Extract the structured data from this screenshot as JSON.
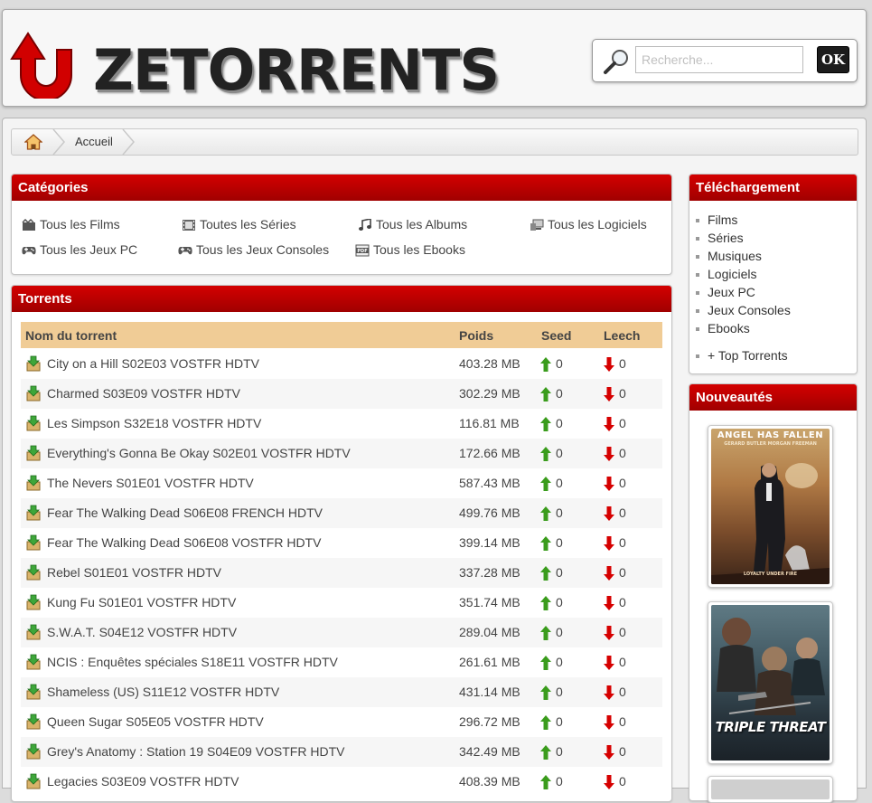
{
  "header": {
    "logo_text": "ZETORRENTS",
    "search_placeholder": "Recherche...",
    "ok_label": "OK"
  },
  "breadcrumb": {
    "home_icon": "home-icon",
    "current": "Accueil"
  },
  "categories": {
    "title": "Catégories",
    "items": [
      {
        "label": "Tous les Films",
        "icon": "film-icon"
      },
      {
        "label": "Toutes les Séries",
        "icon": "filmstrip-icon"
      },
      {
        "label": "Tous les Albums",
        "icon": "music-icon"
      },
      {
        "label": "Tous les Logiciels",
        "icon": "computer-icon"
      },
      {
        "label": "Tous les Jeux PC",
        "icon": "gamepad-icon"
      },
      {
        "label": "Tous les Jeux Consoles",
        "icon": "gamepad-icon"
      },
      {
        "label": "Tous les Ebooks",
        "icon": "pdf-icon"
      }
    ]
  },
  "torrents": {
    "title": "Torrents",
    "columns": {
      "name": "Nom du torrent",
      "size": "Poids",
      "seed": "Seed",
      "leech": "Leech"
    },
    "rows": [
      {
        "name": "City on a Hill S02E03 VOSTFR HDTV",
        "size": "403.28 MB",
        "seed": "0",
        "leech": "0"
      },
      {
        "name": "Charmed S03E09 VOSTFR HDTV",
        "size": "302.29 MB",
        "seed": "0",
        "leech": "0"
      },
      {
        "name": "Les Simpson S32E18 VOSTFR HDTV",
        "size": "116.81 MB",
        "seed": "0",
        "leech": "0"
      },
      {
        "name": "Everything's Gonna Be Okay S02E01 VOSTFR HDTV",
        "size": "172.66 MB",
        "seed": "0",
        "leech": "0"
      },
      {
        "name": "The Nevers S01E01 VOSTFR HDTV",
        "size": "587.43 MB",
        "seed": "0",
        "leech": "0"
      },
      {
        "name": "Fear The Walking Dead S06E08 FRENCH HDTV",
        "size": "499.76 MB",
        "seed": "0",
        "leech": "0"
      },
      {
        "name": "Fear The Walking Dead S06E08 VOSTFR HDTV",
        "size": "399.14 MB",
        "seed": "0",
        "leech": "0"
      },
      {
        "name": "Rebel S01E01 VOSTFR HDTV",
        "size": "337.28 MB",
        "seed": "0",
        "leech": "0"
      },
      {
        "name": "Kung Fu S01E01 VOSTFR HDTV",
        "size": "351.74 MB",
        "seed": "0",
        "leech": "0"
      },
      {
        "name": "S.W.A.T. S04E12 VOSTFR HDTV",
        "size": "289.04 MB",
        "seed": "0",
        "leech": "0"
      },
      {
        "name": "NCIS : Enquêtes spéciales S18E11 VOSTFR HDTV",
        "size": "261.61 MB",
        "seed": "0",
        "leech": "0"
      },
      {
        "name": "Shameless (US) S11E12 VOSTFR HDTV",
        "size": "431.14 MB",
        "seed": "0",
        "leech": "0"
      },
      {
        "name": "Queen Sugar S05E05 VOSTFR HDTV",
        "size": "296.72 MB",
        "seed": "0",
        "leech": "0"
      },
      {
        "name": "Grey's Anatomy : Station 19 S04E09 VOSTFR HDTV",
        "size": "342.49 MB",
        "seed": "0",
        "leech": "0"
      },
      {
        "name": "Legacies S03E09 VOSTFR HDTV",
        "size": "408.39 MB",
        "seed": "0",
        "leech": "0"
      }
    ]
  },
  "telechargement": {
    "title": "Téléchargement",
    "items": [
      "Films",
      "Séries",
      "Musiques",
      "Logiciels",
      "Jeux PC",
      "Jeux Consoles",
      "Ebooks"
    ],
    "top": "+ Top Torrents"
  },
  "nouveautes": {
    "title": "Nouveautés",
    "posters": [
      {
        "title": "ANGEL HAS FALLEN",
        "credits": "GERARD BUTLER   MORGAN FREEMAN",
        "tagline": "LOYALTY UNDER FIRE"
      },
      {
        "title": "TRIPLE THREAT"
      }
    ]
  },
  "colors": {
    "panel_header": "#c40000",
    "table_header": "#f0cc96",
    "seed_arrow": "#3a9c1c",
    "leech_arrow": "#d60000"
  }
}
